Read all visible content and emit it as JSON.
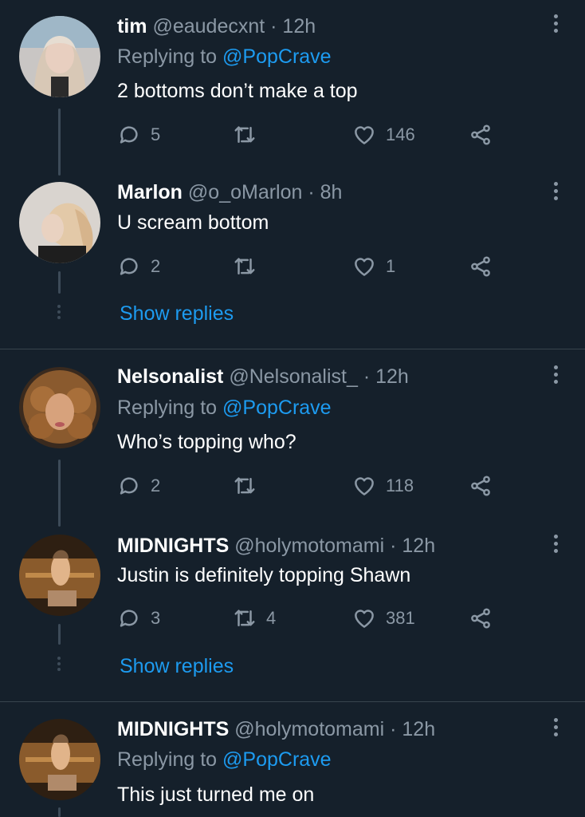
{
  "colors": {
    "background": "#15202b",
    "text": "#ffffff",
    "muted": "#8b98a5",
    "link": "#1d9bf0",
    "divider": "#38444d"
  },
  "tweets": [
    {
      "name": "tim",
      "handle": "@eaudecxnt",
      "time": "· 12h",
      "replying_label": "Replying to",
      "replying_to": "@PopCrave",
      "text": "2 bottoms don’t make a top",
      "replies": "5",
      "retweets": "",
      "likes": "146"
    },
    {
      "name": "Marlon",
      "handle": "@o_oMarlon",
      "time": "· 8h",
      "text": "U scream bottom",
      "replies": "2",
      "retweets": "",
      "likes": "1",
      "show_replies": "Show replies"
    },
    {
      "name": "Nelsonalist",
      "handle": "@Nelsonalist_",
      "time": "· 12h",
      "replying_label": "Replying to",
      "replying_to": "@PopCrave",
      "text": "Who’s topping who?",
      "replies": "2",
      "retweets": "",
      "likes": "118"
    },
    {
      "name": "MIDNIGHTS",
      "handle": "@holymotomami",
      "time": "· 12h",
      "text": "Justin is definitely topping Shawn",
      "replies": "3",
      "retweets": "4",
      "likes": "381",
      "show_replies": "Show replies"
    },
    {
      "name": "MIDNIGHTS",
      "handle": "@holymotomami",
      "time": "· 12h",
      "replying_label": "Replying to",
      "replying_to": "@PopCrave",
      "text": "This just turned me on"
    }
  ]
}
